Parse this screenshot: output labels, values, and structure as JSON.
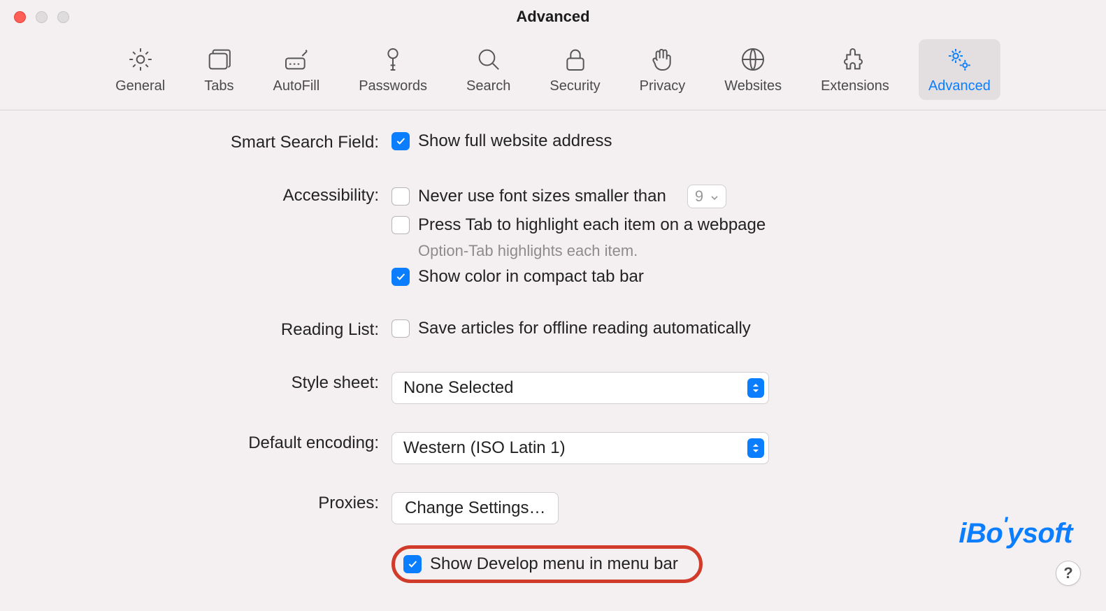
{
  "window": {
    "title": "Advanced"
  },
  "toolbar": {
    "items": [
      {
        "label": "General"
      },
      {
        "label": "Tabs"
      },
      {
        "label": "AutoFill"
      },
      {
        "label": "Passwords"
      },
      {
        "label": "Search"
      },
      {
        "label": "Security"
      },
      {
        "label": "Privacy"
      },
      {
        "label": "Websites"
      },
      {
        "label": "Extensions"
      },
      {
        "label": "Advanced"
      }
    ]
  },
  "labels": {
    "smartSearch": "Smart Search Field:",
    "accessibility": "Accessibility:",
    "readingList": "Reading List:",
    "styleSheet": "Style sheet:",
    "defaultEncoding": "Default encoding:",
    "proxies": "Proxies:"
  },
  "options": {
    "showFullAddress": "Show full website address",
    "neverFontSmaller": "Never use font sizes smaller than",
    "fontSizeValue": "9",
    "pressTab": "Press Tab to highlight each item on a webpage",
    "optionTabHint": "Option-Tab highlights each item.",
    "showColorCompact": "Show color in compact tab bar",
    "saveArticlesOffline": "Save articles for offline reading automatically",
    "styleSheetValue": "None Selected",
    "defaultEncodingValue": "Western (ISO Latin 1)",
    "changeSettings": "Change Settings…",
    "showDevelopMenu": "Show Develop menu in menu bar"
  },
  "watermark": "iBoysoft",
  "help": "?"
}
